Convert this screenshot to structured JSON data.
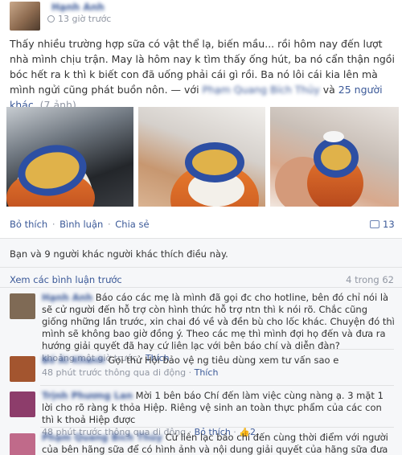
{
  "post": {
    "author": "Hạnh Anh",
    "time": "13 giờ trước",
    "text_before": "Thấy nhiều trường hợp sữa có vật thể lạ, biến mầu... rồi hôm nay đến lượt nhà mình chịu trận. May là hôm nay k tìm thấy ống hút, ba nó cẩn thận ngồi bóc hết ra k thì k biết con đã uống phải cái gì rồi. Ba nó lôi cái kia lên mà mình ngửi cũng phát buồn nôn. — với",
    "tagged_person": "Phạm Quang Bích Thủy",
    "tag_conjunction": "và",
    "tagged_others": "25 người khác.",
    "photo_count": "(7 ảnh)"
  },
  "actions": {
    "like": "Bỏ thích",
    "comment": "Bình luận",
    "share": "Chia sẻ",
    "separator": " · ",
    "share_count": "13"
  },
  "likes_summary": "Bạn và 9 người khác người khác thích điều này.",
  "comments_header": {
    "view_previous": "Xem các bình luận trước",
    "count": "4 trong 62"
  },
  "comments": [
    {
      "author": "Hạnh Anh",
      "text": "Báo cáo các mẹ là mình đã gọi đc cho hotline, bên đó chỉ nói là sẽ cử người đến hỗ trợ còn hình thức hỗ trợ ntn thì k nói rõ. Chắc cũng giống những lần trước, xin chai đó về và đền bù cho lốc khác. Chuyện đó thì mình sẽ không bao giờ đồng ý. Theo các mẹ thì mình đợi họ đến và đưa ra hướng giải quyết đã hay cứ liên lạc với bên báo chí và diễn đàn?",
      "time": "khoảng một giờ trước",
      "like_label": "Thích",
      "avatar_color": "#7f6a55"
    },
    {
      "author": "Bố Ái Khanh",
      "text": "Gọi thử Hội bảo vệ ng tiêu dùng xem tư vấn sao e",
      "time": "48 phút trước thông qua di động",
      "like_label": "Thích",
      "avatar_color": "#a3552f"
    },
    {
      "author": "Trịnh Phương Lan",
      "text": "Mời 1 bên báo Chí đến làm việc cùng nàng ạ. 3 mặt 1 lời cho rõ ràng k thỏa Hiệp. Riêng vệ sinh an toàn thực phẩm của các con thì k thoả Hiệp được",
      "time": "48 phút trước thông qua di động",
      "like_label": "Bỏ thích",
      "reactions": "2",
      "avatar_color": "#8d3d6b"
    },
    {
      "author": "Phạm Quang Bích Thủy",
      "text": "Cứ liên lạc báo chí đến cùng thời điểm với người của bên hãng sữa để có hình ảnh và nội dung giải quyết của hãng sữa đưa lên báo cho chân thực cậu",
      "avatar_color": "#c06a8a"
    }
  ],
  "colors": {
    "link": "#3b5998",
    "muted": "#9197a3",
    "feedback_bg": "#f6f7f9",
    "cap_blue": "#2d4fa3"
  }
}
